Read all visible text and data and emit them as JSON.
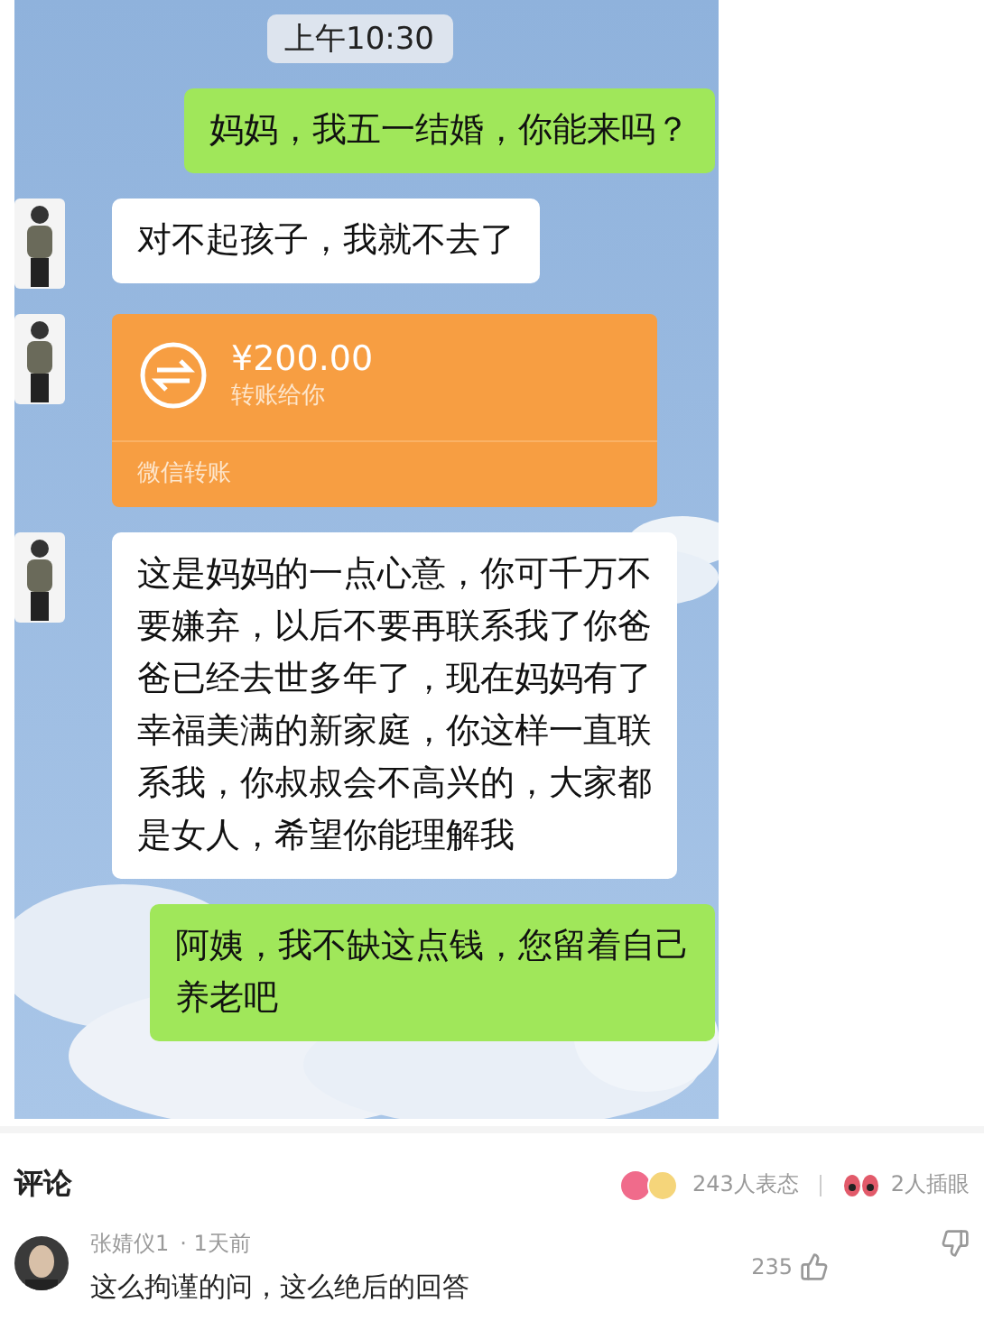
{
  "chat": {
    "time": "上午10:30",
    "messages": [
      {
        "kind": "text",
        "sent": true,
        "text": "妈妈，我五一结婚，你能来吗？"
      },
      {
        "kind": "text",
        "sent": false,
        "text": "对不起孩子，我就不去了"
      },
      {
        "kind": "transfer",
        "sent": false,
        "amount": "¥200.00",
        "note": "转账给你",
        "footer": "微信转账"
      },
      {
        "kind": "text",
        "sent": false,
        "text": "这是妈妈的一点心意，你可千万不要嫌弃，以后不要再联系我了你爸爸已经去世多年了，现在妈妈有了幸福美满的新家庭，你这样一直联系我，你叔叔会不高兴的，大家都是女人，希望你能理解我"
      },
      {
        "kind": "text",
        "sent": true,
        "text": "阿姨，我不缺这点钱，您留着自己养老吧"
      }
    ]
  },
  "comments_header": {
    "title": "评论",
    "reactions": "243人表态",
    "bookmarks": "2人插眼"
  },
  "comments": [
    {
      "author": "张婧仪1",
      "time": "· 1天前",
      "text": "这么拘谨的问，这么绝后的回答",
      "likes": "235"
    }
  ]
}
